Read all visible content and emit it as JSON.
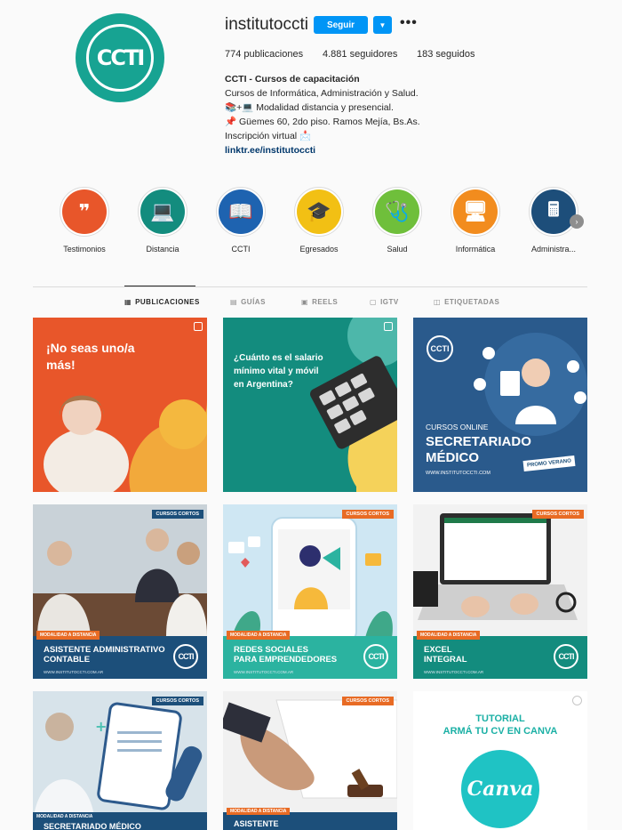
{
  "profile": {
    "username": "institutoccti",
    "avatar_text": "CCTI",
    "follow_label": "Seguir",
    "dropdown_icon": "chevron-down-icon",
    "more_icon": "more-icon",
    "more_glyph": "•••",
    "stats": {
      "posts": "774 publicaciones",
      "followers": "4.881 seguidores",
      "following": "183 seguidos"
    },
    "bio": {
      "name": "CCTI - Cursos de capacitación",
      "line1": "Cursos de Informática, Administración y Salud.",
      "line2": "📚+💻 Modalidad distancia y presencial.",
      "line3": "📌 Güemes 60, 2do piso. Ramos Mejía, Bs.As.",
      "line4": "Inscripción virtual 📩",
      "link": "linktr.ee/institutoccti"
    }
  },
  "highlights": [
    {
      "label": "Testimonios",
      "icon": "quote-icon",
      "glyph": "❞",
      "color": "#e8562a"
    },
    {
      "label": "Distancia",
      "icon": "laptop-icon",
      "glyph": "💻",
      "color": "#138c7e"
    },
    {
      "label": "CCTI",
      "icon": "book-icon",
      "glyph": "📖",
      "color": "#1e63b0"
    },
    {
      "label": "Egresados",
      "icon": "graduation-cap-icon",
      "glyph": "🎓",
      "color": "#f2c014"
    },
    {
      "label": "Salud",
      "icon": "stethoscope-icon",
      "glyph": "🩺",
      "color": "#6fbf3b"
    },
    {
      "label": "Informática",
      "icon": "monitor-icon",
      "glyph": "🖥",
      "color": "#f28c1e"
    },
    {
      "label": "Administra...",
      "icon": "calculator-icon",
      "glyph": "🖩",
      "color": "#1d4e7a"
    }
  ],
  "tabs": [
    {
      "label": "PUBLICACIONES",
      "icon": "grid-icon",
      "glyph": "▦",
      "active": true
    },
    {
      "label": "GUÍAS",
      "icon": "guide-icon",
      "glyph": "▤",
      "active": false
    },
    {
      "label": "REELS",
      "icon": "reels-icon",
      "glyph": "▣",
      "active": false
    },
    {
      "label": "IGTV",
      "icon": "igtv-icon",
      "glyph": "▢",
      "active": false
    },
    {
      "label": "ETIQUETADAS",
      "icon": "tag-icon",
      "glyph": "◫",
      "active": false
    }
  ],
  "posts": {
    "p1": {
      "text": "¡No seas uno/a más!",
      "bg": "#e8562a"
    },
    "p2": {
      "text": "¿Cuánto es el salario mínimo vital y móvil en Argentina?",
      "bg": "#138c7e"
    },
    "p3": {
      "line1": "CURSOS ONLINE",
      "line2": "SECRETARIADO",
      "line3": "MÉDICO",
      "promo": "PROMO VERANO",
      "url": "WWW.INSTITUTOCCTI.COM",
      "bg": "#2a5a8c"
    },
    "p4": {
      "badge": "CURSOS CORTOS",
      "tag": "MODALIDAD A DISTANCIA",
      "title1": "ASISTENTE ADMINISTRATIVO",
      "title2": "CONTABLE",
      "sub": "WWW.INSTITUTOCCTI.COM.AR",
      "bg": "#1c4f7a"
    },
    "p5": {
      "badge": "CURSOS CORTOS",
      "tag": "MODALIDAD A DISTANCIA",
      "title1": "REDES SOCIALES",
      "title2": "PARA EMPRENDEDORES",
      "sub": "WWW.INSTITUTOCCTI.COM.AR",
      "bg": "#2bb3a0"
    },
    "p6": {
      "badge": "CURSOS CORTOS",
      "tag": "MODALIDAD A DISTANCIA",
      "title1": "EXCEL",
      "title2": "INTEGRAL",
      "sub": "WWW.INSTITUTOCCTI.COM.AR",
      "bg": "#138c7e"
    },
    "p7": {
      "badge": "CURSOS CORTOS",
      "tag": "MODALIDAD A DISTANCIA",
      "title1": "SECRETARIADO MÉDICO",
      "bg": "#1c4f7a"
    },
    "p8": {
      "badge": "CURSOS CORTOS",
      "tag": "MODALIDAD A DISTANCIA",
      "title1": "ASISTENTE",
      "bg": "#1c4f7a"
    },
    "p9": {
      "line1": "TUTORIAL",
      "line2": "ARMÁ TU CV EN CANVA",
      "logo": "Canva",
      "bg": "#ffffff"
    }
  }
}
